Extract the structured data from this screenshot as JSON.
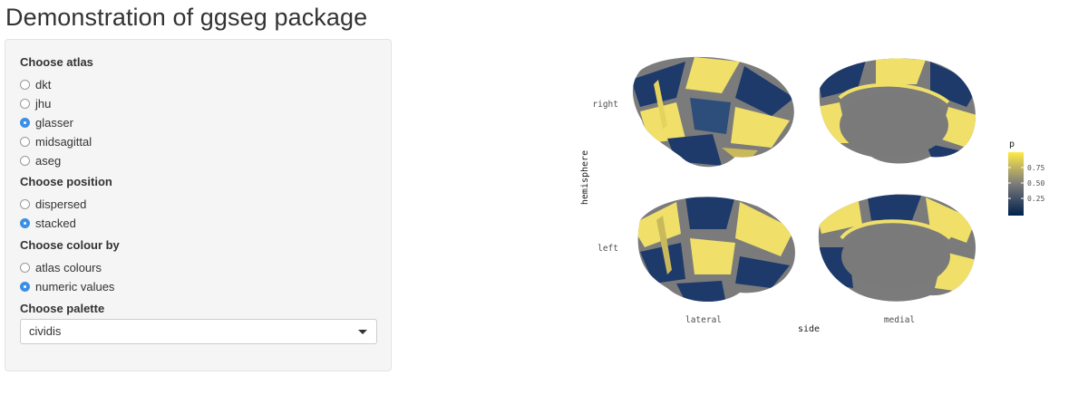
{
  "page_title": "Demonstration of ggseg package",
  "sidebar": {
    "groups": [
      {
        "label": "Choose atlas",
        "options": [
          {
            "label": "dkt",
            "checked": false
          },
          {
            "label": "jhu",
            "checked": false
          },
          {
            "label": "glasser",
            "checked": true
          },
          {
            "label": "midsagittal",
            "checked": false
          },
          {
            "label": "aseg",
            "checked": false
          }
        ]
      },
      {
        "label": "Choose position",
        "options": [
          {
            "label": "dispersed",
            "checked": false
          },
          {
            "label": "stacked",
            "checked": true
          }
        ]
      },
      {
        "label": "Choose colour by",
        "options": [
          {
            "label": "atlas colours",
            "checked": false
          },
          {
            "label": "numeric values",
            "checked": true
          }
        ]
      }
    ],
    "palette": {
      "label": "Choose palette",
      "value": "cividis"
    }
  },
  "plot": {
    "row_labels": [
      "right",
      "left"
    ],
    "col_labels": [
      "lateral",
      "medial"
    ],
    "ylabel": "hemisphere",
    "xlabel": "side",
    "legend": {
      "title": "p",
      "ticks": [
        "0.75",
        "0.50",
        "0.25"
      ]
    },
    "colors": {
      "dark": "#1d3a6b",
      "mid": "#7b7b7b",
      "light": "#f0e06a",
      "medial_wall": "#7a7a7a"
    }
  }
}
